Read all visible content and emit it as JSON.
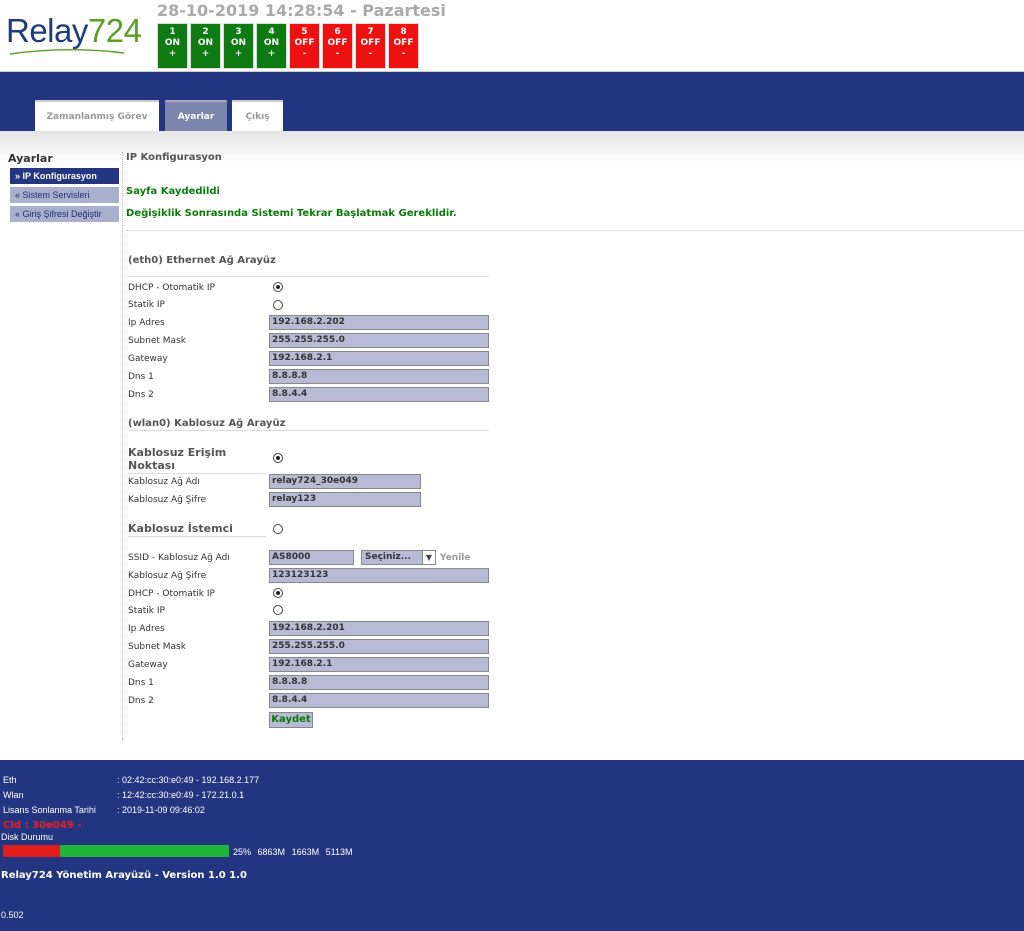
{
  "header": {
    "logo_text": "Relay",
    "logo_num": "724",
    "datetime": "28-10-2019 14:28:54 - Pazartesi",
    "relays": [
      {
        "n": "1",
        "state": "ON",
        "sym": "+",
        "color": "#0d7a12"
      },
      {
        "n": "2",
        "state": "ON",
        "sym": "+",
        "color": "#0d7a12"
      },
      {
        "n": "3",
        "state": "ON",
        "sym": "+",
        "color": "#0d7a12"
      },
      {
        "n": "4",
        "state": "ON",
        "sym": "+",
        "color": "#0d7a12"
      },
      {
        "n": "5",
        "state": "OFF",
        "sym": "-",
        "color": "#ee1111"
      },
      {
        "n": "6",
        "state": "OFF",
        "sym": "-",
        "color": "#ee1111"
      },
      {
        "n": "7",
        "state": "OFF",
        "sym": "-",
        "color": "#ee1111"
      },
      {
        "n": "8",
        "state": "OFF",
        "sym": "-",
        "color": "#ee1111"
      }
    ]
  },
  "nav": {
    "tabs": [
      "Zamanlanmış Görev",
      "Ayarlar",
      "Çıkış"
    ]
  },
  "sidebar": {
    "title": "Ayarlar",
    "items": [
      "» IP Konfigurasyon",
      "« Sistem Servisleri",
      "« Giriş Şifresi Değiştir"
    ]
  },
  "main": {
    "title": "IP Konfigurasyon",
    "msg_saved": "Sayfa Kaydedildi",
    "msg_restart": "Değişiklik Sonrasında Sistemi Tekrar Başlatmak Gereklidir.",
    "eth": {
      "title": "(eth0) Ethernet Ağ Arayüz",
      "dhcp_label": "DHCP - Otomatik IP",
      "static_label": "Statik IP",
      "ip_label": "Ip Adres",
      "ip": "192.168.2.202",
      "mask_label": "Subnet Mask",
      "mask": "255.255.255.0",
      "gw_label": "Gateway",
      "gw": "192.168.2.1",
      "dns1_label": "Dns 1",
      "dns1": "8.8.8.8",
      "dns2_label": "Dns 2",
      "dns2": "8.8.4.4"
    },
    "wlan": {
      "title": "(wlan0) Kablosuz Ağ Arayüz",
      "ap_title": "Kablosuz Erişim Noktası",
      "ap_name_label": "Kablosuz Ağ Adı",
      "ap_name": "relay724_30e049",
      "ap_pass_label": "Kablosuz Ağ Şifre",
      "ap_pass": "relay123",
      "client_title": "Kablosuz İstemci",
      "ssid_label": "SSID - Kablosuz Ağ Adı",
      "ssid": "AS8000",
      "ssid_select": "Seçiniz...",
      "refresh": "Yenile",
      "pass_label": "Kablosuz Ağ Şifre",
      "pass": "123123123",
      "dhcp_label": "DHCP - Otomatik IP",
      "static_label": "Statik IP",
      "ip_label": "Ip Adres",
      "ip": "192.168.2.201",
      "mask_label": "Subnet Mask",
      "mask": "255.255.255.0",
      "gw_label": "Gateway",
      "gw": "192.168.2.1",
      "dns1_label": "Dns 1",
      "dns1": "8.8.8.8",
      "dns2_label": "Dns 2",
      "dns2": "8.8.4.4"
    },
    "save_label": "Kaydet"
  },
  "footer": {
    "eth_label": "Eth",
    "eth_val": ": 02:42:cc:30:e0:49 - 192.168.2.177",
    "wlan_label": "Wlan",
    "wlan_val": ": 12:42:cc:30:e0:49 - 172.21.0.1",
    "license_label": "Lisans Sonlanma Tarihi",
    "license_val": ": 2019-11-09 09:46:02",
    "cid": "CId : 30e049 -",
    "disk_label": "Disk Durumu",
    "disk_percent": "25%",
    "disk_used_fraction": 0.25,
    "disk_total": "6863M",
    "disk_used": "1663M",
    "disk_free": "5113M",
    "version": "Relay724 Yönetim Arayüzü - Version 1.0 1.0",
    "timing": "0.502"
  }
}
